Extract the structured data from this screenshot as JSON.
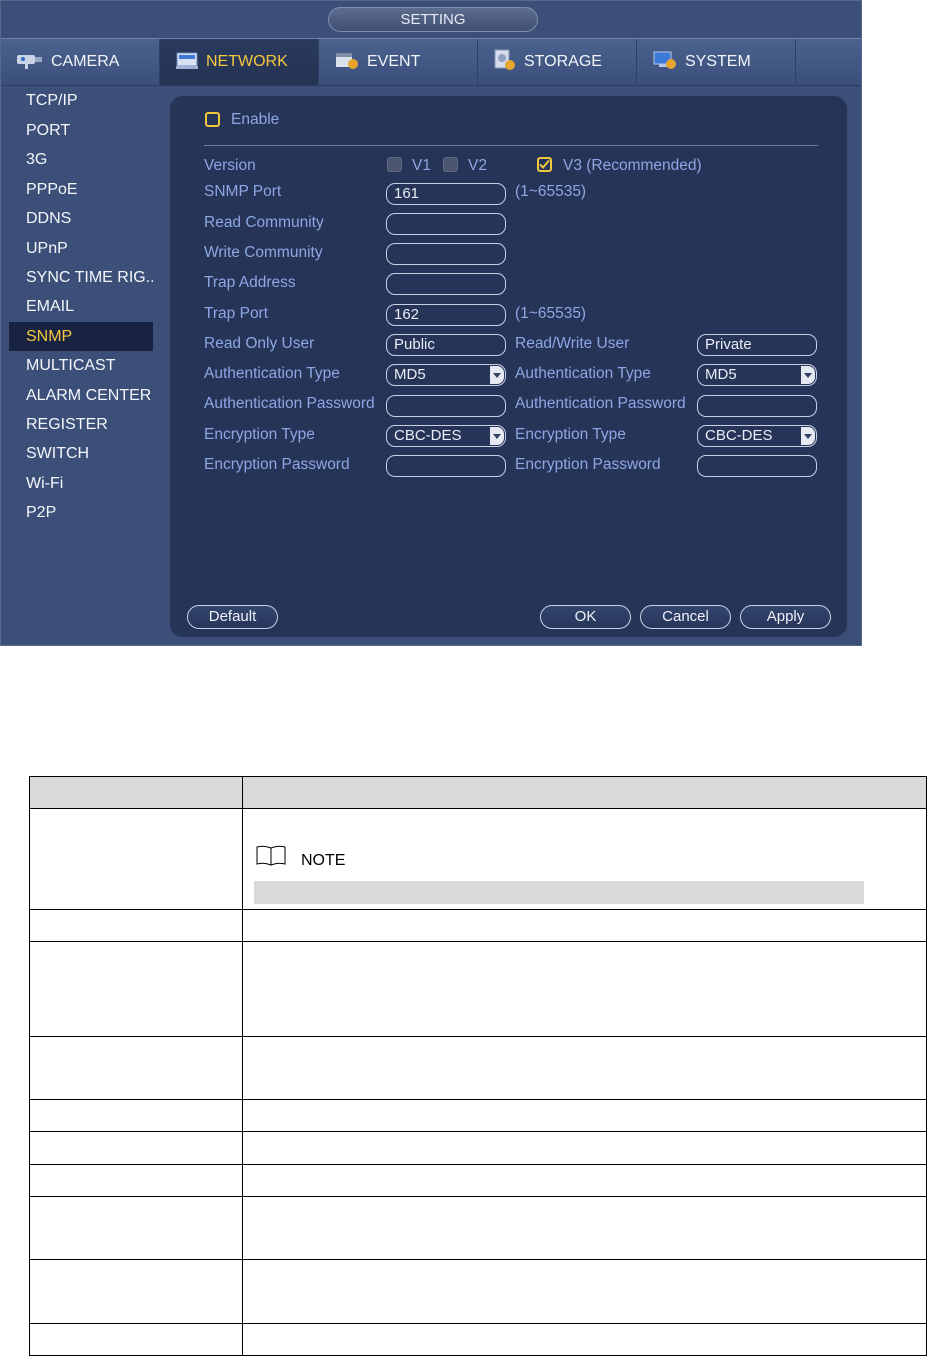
{
  "window": {
    "title": "SETTING"
  },
  "tabs": [
    {
      "label": "CAMERA",
      "icon": "camera-icon",
      "active": false
    },
    {
      "label": "NETWORK",
      "icon": "network-icon",
      "active": true
    },
    {
      "label": "EVENT",
      "icon": "event-icon",
      "active": false
    },
    {
      "label": "STORAGE",
      "icon": "storage-icon",
      "active": false
    },
    {
      "label": "SYSTEM",
      "icon": "system-icon",
      "active": false
    }
  ],
  "sidebar": {
    "items": [
      {
        "label": "TCP/IP"
      },
      {
        "label": "PORT"
      },
      {
        "label": "3G"
      },
      {
        "label": "PPPoE"
      },
      {
        "label": "DDNS"
      },
      {
        "label": "UPnP"
      },
      {
        "label": "SYNC TIME RIG..."
      },
      {
        "label": "EMAIL"
      },
      {
        "label": "SNMP",
        "active": true
      },
      {
        "label": "MULTICAST"
      },
      {
        "label": "ALARM CENTER"
      },
      {
        "label": "REGISTER"
      },
      {
        "label": "SWITCH"
      },
      {
        "label": "Wi-Fi"
      },
      {
        "label": "P2P"
      }
    ]
  },
  "form": {
    "enable": {
      "label": "Enable",
      "checked": false
    },
    "version": {
      "label": "Version",
      "v1": {
        "label": "V1",
        "checked": false
      },
      "v2": {
        "label": "V2",
        "checked": false
      },
      "v3": {
        "label": "V3 (Recommended)",
        "checked": true
      }
    },
    "snmp_port": {
      "label": "SNMP Port",
      "value": "161",
      "range": "(1~65535)"
    },
    "read_community": {
      "label": "Read Community",
      "value": ""
    },
    "write_community": {
      "label": "Write Community",
      "value": ""
    },
    "trap_address": {
      "label": "Trap Address",
      "value": ""
    },
    "trap_port": {
      "label": "Trap Port",
      "value": "162",
      "range": "(1~65535)"
    },
    "read_only_user": {
      "label": "Read Only User",
      "value": "Public"
    },
    "read_write_user": {
      "label": "Read/Write User",
      "value": "Private"
    },
    "ro_auth_type": {
      "label": "Authentication Type",
      "value": "MD5"
    },
    "rw_auth_type": {
      "label": "Authentication Type",
      "value": "MD5"
    },
    "ro_auth_password": {
      "label": "Authentication Password",
      "value": ""
    },
    "rw_auth_password": {
      "label": "Authentication Password",
      "value": ""
    },
    "ro_enc_type": {
      "label": "Encryption Type",
      "value": "CBC-DES"
    },
    "rw_enc_type": {
      "label": "Encryption Type",
      "value": "CBC-DES"
    },
    "ro_enc_password": {
      "label": "Encryption Password",
      "value": ""
    },
    "rw_enc_password": {
      "label": "Encryption Password",
      "value": ""
    }
  },
  "buttons": {
    "default": "Default",
    "ok": "OK",
    "cancel": "Cancel",
    "apply": "Apply"
  },
  "doc": {
    "note_label": "NOTE"
  },
  "colors": {
    "window_bg": "#3b4f79",
    "panel_bg": "#263458",
    "label": "#8ea6e3",
    "active": "#f5c840"
  }
}
